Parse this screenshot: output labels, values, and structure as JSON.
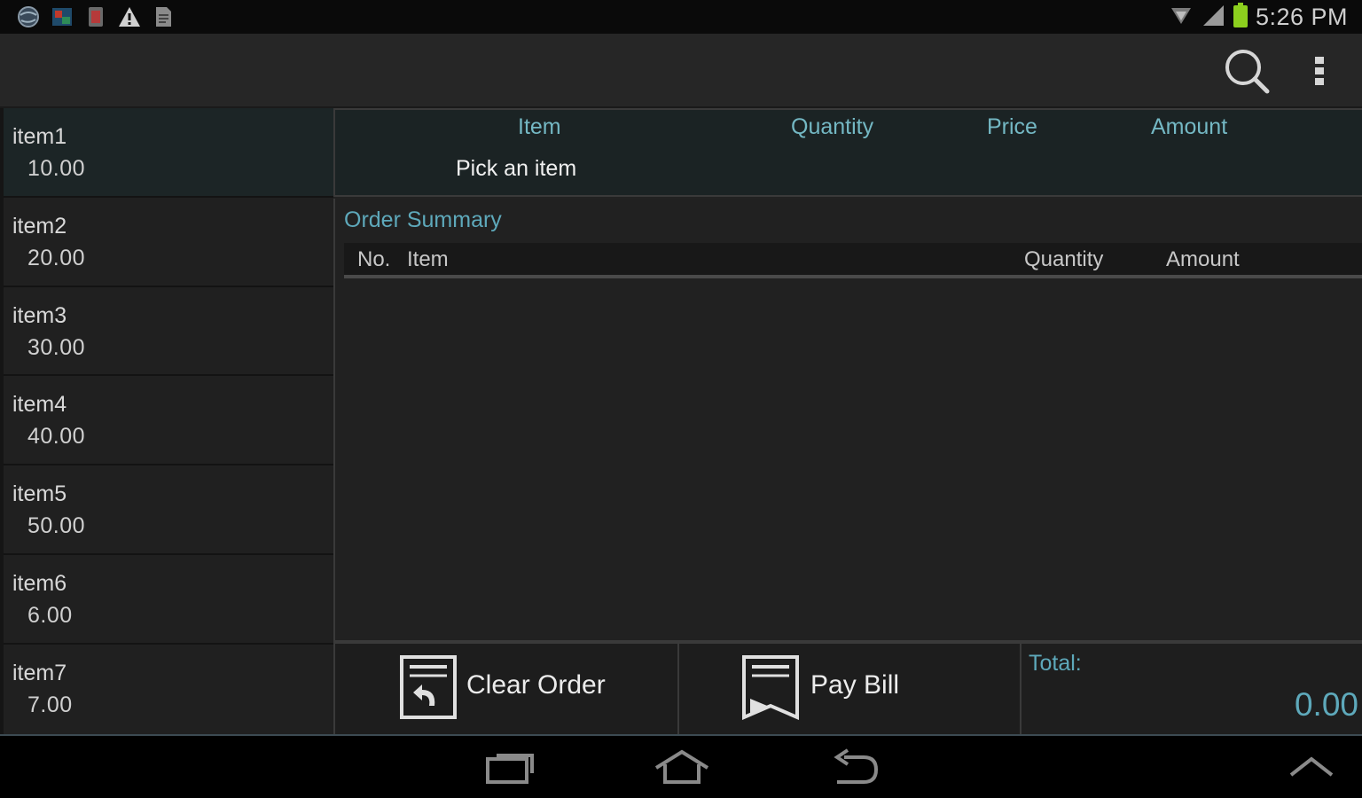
{
  "status_bar": {
    "time": "5:26 PM",
    "notification_icons": [
      "globe-icon",
      "image-icon",
      "app-icon",
      "warning-icon",
      "document-icon"
    ],
    "system_icons": [
      "wifi-icon",
      "signal-icon",
      "battery-icon"
    ]
  },
  "action_bar": {
    "actions": [
      "search-icon",
      "overflow-menu-icon"
    ]
  },
  "items": [
    {
      "name": "item1",
      "price": "10.00"
    },
    {
      "name": "item2",
      "price": "20.00"
    },
    {
      "name": "item3",
      "price": "30.00"
    },
    {
      "name": "item4",
      "price": "40.00"
    },
    {
      "name": "item5",
      "price": "50.00"
    },
    {
      "name": "item6",
      "price": "6.00"
    },
    {
      "name": "item7",
      "price": "7.00"
    }
  ],
  "order_entry": {
    "columns": [
      "Item",
      "Quantity",
      "Price",
      "Amount"
    ],
    "placeholder": "Pick an item"
  },
  "summary": {
    "title": "Order Summary",
    "columns": [
      "No.",
      "Item",
      "Quantity",
      "Amount"
    ]
  },
  "actions": {
    "clear_label": "Clear Order",
    "pay_label": "Pay Bill"
  },
  "total": {
    "label": "Total:",
    "value": "0.00"
  },
  "nav_bar": [
    "recent-apps-icon",
    "home-icon",
    "back-icon",
    "menu-up-icon"
  ],
  "colors": {
    "accent": "#5ea9bb",
    "header_text": "#74b8c4",
    "background": "#222222"
  }
}
